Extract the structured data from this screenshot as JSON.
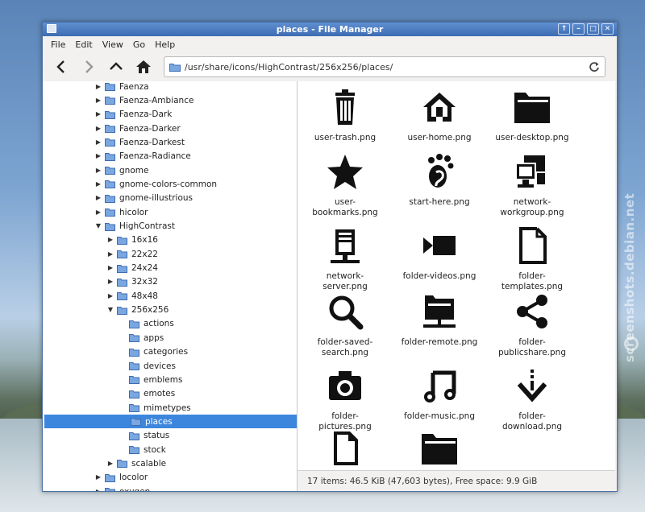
{
  "window": {
    "title": "places - File Manager"
  },
  "menu": [
    "File",
    "Edit",
    "View",
    "Go",
    "Help"
  ],
  "location": {
    "path": "/usr/share/icons/HighContrast/256x256/places/"
  },
  "tree": [
    {
      "label": "Faenza",
      "depth": 0,
      "expander": "collapsed"
    },
    {
      "label": "Faenza-Ambiance",
      "depth": 0,
      "expander": "collapsed"
    },
    {
      "label": "Faenza-Dark",
      "depth": 0,
      "expander": "collapsed"
    },
    {
      "label": "Faenza-Darker",
      "depth": 0,
      "expander": "collapsed"
    },
    {
      "label": "Faenza-Darkest",
      "depth": 0,
      "expander": "collapsed"
    },
    {
      "label": "Faenza-Radiance",
      "depth": 0,
      "expander": "collapsed"
    },
    {
      "label": "gnome",
      "depth": 0,
      "expander": "collapsed"
    },
    {
      "label": "gnome-colors-common",
      "depth": 0,
      "expander": "collapsed"
    },
    {
      "label": "gnome-illustrious",
      "depth": 0,
      "expander": "collapsed"
    },
    {
      "label": "hicolor",
      "depth": 0,
      "expander": "collapsed"
    },
    {
      "label": "HighContrast",
      "depth": 0,
      "expander": "expanded"
    },
    {
      "label": "16x16",
      "depth": 1,
      "expander": "collapsed"
    },
    {
      "label": "22x22",
      "depth": 1,
      "expander": "collapsed"
    },
    {
      "label": "24x24",
      "depth": 1,
      "expander": "collapsed"
    },
    {
      "label": "32x32",
      "depth": 1,
      "expander": "collapsed"
    },
    {
      "label": "48x48",
      "depth": 1,
      "expander": "collapsed"
    },
    {
      "label": "256x256",
      "depth": 1,
      "expander": "expanded"
    },
    {
      "label": "actions",
      "depth": 2,
      "expander": "none"
    },
    {
      "label": "apps",
      "depth": 2,
      "expander": "none"
    },
    {
      "label": "categories",
      "depth": 2,
      "expander": "none"
    },
    {
      "label": "devices",
      "depth": 2,
      "expander": "none"
    },
    {
      "label": "emblems",
      "depth": 2,
      "expander": "none"
    },
    {
      "label": "emotes",
      "depth": 2,
      "expander": "none"
    },
    {
      "label": "mimetypes",
      "depth": 2,
      "expander": "none"
    },
    {
      "label": "places",
      "depth": 2,
      "expander": "none",
      "selected": true
    },
    {
      "label": "status",
      "depth": 2,
      "expander": "none"
    },
    {
      "label": "stock",
      "depth": 2,
      "expander": "none"
    },
    {
      "label": "scalable",
      "depth": 1,
      "expander": "collapsed"
    },
    {
      "label": "locolor",
      "depth": 0,
      "expander": "collapsed"
    },
    {
      "label": "oxygen",
      "depth": 0,
      "expander": "collapsed"
    }
  ],
  "files": [
    {
      "name": "user-trash.png",
      "icon": "trash-icon"
    },
    {
      "name": "user-home.png",
      "icon": "home-icon"
    },
    {
      "name": "user-desktop.png",
      "icon": "folder-icon"
    },
    {
      "name": "user-bookmarks.png",
      "icon": "star-icon"
    },
    {
      "name": "start-here.png",
      "icon": "gnome-foot-icon"
    },
    {
      "name": "network-workgroup.png",
      "icon": "network-workgroup-icon"
    },
    {
      "name": "network-server.png",
      "icon": "server-icon"
    },
    {
      "name": "folder-videos.png",
      "icon": "video-camera-icon"
    },
    {
      "name": "folder-templates.png",
      "icon": "template-icon"
    },
    {
      "name": "folder-saved-search.png",
      "icon": "magnifier-icon"
    },
    {
      "name": "folder-remote.png",
      "icon": "remote-folder-icon"
    },
    {
      "name": "folder-publicshare.png",
      "icon": "share-icon"
    },
    {
      "name": "folder-pictures.png",
      "icon": "camera-icon"
    },
    {
      "name": "folder-music.png",
      "icon": "music-icon"
    },
    {
      "name": "folder-download.png",
      "icon": "download-icon"
    },
    {
      "name": "",
      "icon": "document-icon"
    },
    {
      "name": "",
      "icon": "folder-icon"
    }
  ],
  "status": {
    "text": "17 items: 46.5 KiB (47,603 bytes), Free space: 9.9 GiB"
  },
  "watermark": {
    "text": "screenshots.debian.net"
  },
  "colors": {
    "titlebar": "#4a7cc2",
    "selection": "#3d86dd",
    "window_bg": "#f2f1f0"
  }
}
